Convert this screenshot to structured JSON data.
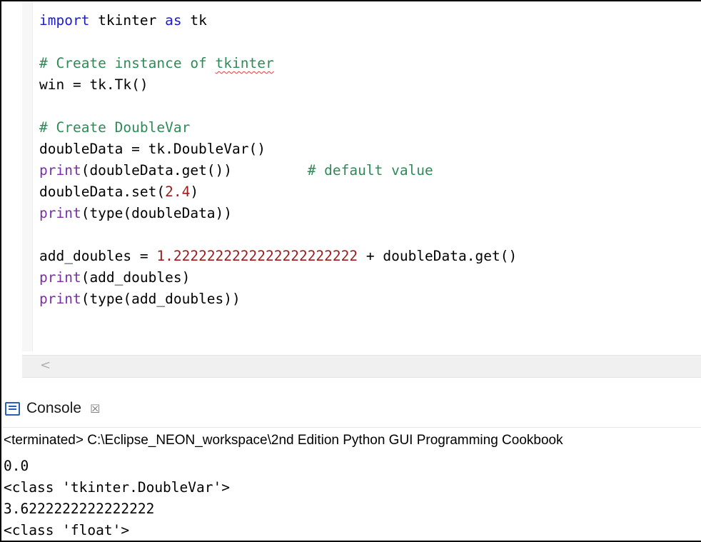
{
  "editor": {
    "code_lines": [
      [
        {
          "t": "import",
          "c": "kw"
        },
        {
          "t": " tkinter ",
          "c": ""
        },
        {
          "t": "as",
          "c": "kw"
        },
        {
          "t": " tk",
          "c": ""
        }
      ],
      [],
      [
        {
          "t": "# Create instance of ",
          "c": "cm"
        },
        {
          "t": "tkinter",
          "c": "cm squiggle"
        }
      ],
      [
        {
          "t": "win = tk.Tk()",
          "c": ""
        }
      ],
      [],
      [
        {
          "t": "# Create DoubleVar",
          "c": "cm"
        }
      ],
      [
        {
          "t": "doubleData = tk.DoubleVar()",
          "c": ""
        }
      ],
      [
        {
          "t": "print",
          "c": "fn"
        },
        {
          "t": "(doubleData.get())         ",
          "c": ""
        },
        {
          "t": "# default value",
          "c": "cm"
        }
      ],
      [
        {
          "t": "doubleData.set(",
          "c": ""
        },
        {
          "t": "2.4",
          "c": "num"
        },
        {
          "t": ")",
          "c": ""
        }
      ],
      [
        {
          "t": "print",
          "c": "fn"
        },
        {
          "t": "(type(doubleData))",
          "c": ""
        }
      ],
      [],
      [
        {
          "t": "add_doubles = ",
          "c": ""
        },
        {
          "t": "1.2222222222222222222222",
          "c": "num"
        },
        {
          "t": " + doubleData.get()",
          "c": ""
        }
      ],
      [
        {
          "t": "print",
          "c": "fn"
        },
        {
          "t": "(add_doubles)",
          "c": ""
        }
      ],
      [
        {
          "t": "print",
          "c": "fn"
        },
        {
          "t": "(type(add_doubles))",
          "c": ""
        }
      ]
    ],
    "scroll_left_glyph": "<"
  },
  "console": {
    "tab_label": "Console",
    "close_glyph": "☒",
    "status": "<terminated> C:\\Eclipse_NEON_workspace\\2nd Edition Python GUI Programming Cookbook",
    "output_lines": [
      "0.0",
      "<class 'tkinter.DoubleVar'>",
      "3.6222222222222222",
      "<class 'float'>"
    ]
  },
  "colors": {
    "keyword": "#1b1bd6",
    "comment": "#2e8b57",
    "number": "#9e1b1b",
    "builtin": "#7b2fa6"
  },
  "icons": {
    "console_icon": "console-icon",
    "close_icon": "close-icon",
    "scroll_left_icon": "chevron-left-icon"
  }
}
